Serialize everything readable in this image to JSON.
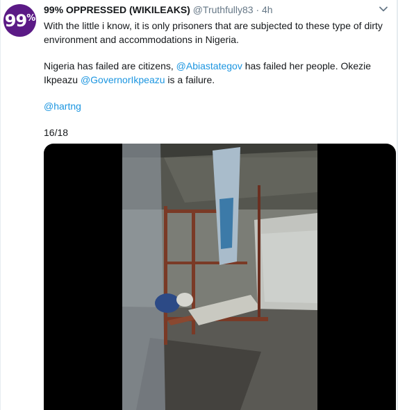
{
  "user": {
    "name": "99% OPPRESSED (WIKILEAKS)",
    "handle": "@Truthfully83",
    "separator": "·",
    "time": "4h",
    "avatar_text": "99",
    "avatar_sup": "%"
  },
  "tweet": {
    "paragraph1": "With the little i know, it is only prisoners that are subjected to these type of dirty environment and accommodations in Nigeria.",
    "p2_part1": "Nigeria has failed are citizens, ",
    "p2_mention1": "@Abiastategov",
    "p2_part2": " has failed her people. Okezie Ikpeazu ",
    "p2_mention2": "@GovernorIkpeazu",
    "p2_part3": " is a failure.",
    "mention3": "@hartng",
    "thread_count": "16/18"
  },
  "icons": {
    "caret": "chevron-down-icon"
  },
  "colors": {
    "link": "#1b95e0",
    "avatar_bg": "#5b1a86",
    "secondary_text": "#657786"
  }
}
